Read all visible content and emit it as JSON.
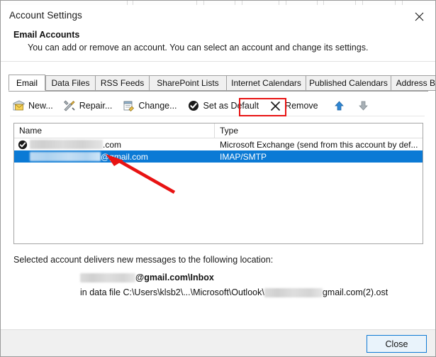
{
  "window": {
    "title": "Account Settings",
    "close_icon": "close-x-icon"
  },
  "header": {
    "heading": "Email Accounts",
    "description": "You can add or remove an account. You can select an account and change its settings."
  },
  "tabs": [
    {
      "label": "Email",
      "active": true
    },
    {
      "label": "Data Files",
      "active": false
    },
    {
      "label": "RSS Feeds",
      "active": false
    },
    {
      "label": "SharePoint Lists",
      "active": false
    },
    {
      "label": "Internet Calendars",
      "active": false
    },
    {
      "label": "Published Calendars",
      "active": false
    },
    {
      "label": "Address Books",
      "active": false
    }
  ],
  "toolbar": {
    "new_label": "New...",
    "repair_label": "Repair...",
    "change_label": "Change...",
    "set_default_label": "Set as Default",
    "remove_label": "Remove",
    "move_up_icon": "arrow-up-icon",
    "move_down_icon": "arrow-down-icon"
  },
  "list": {
    "columns": [
      "Name",
      "Type"
    ],
    "rows": [
      {
        "is_default": true,
        "name_redacted": true,
        "name_suffix": ".com",
        "type": "Microsoft Exchange (send from this account by def...",
        "selected": false
      },
      {
        "is_default": false,
        "name_redacted": true,
        "name_suffix": "@gmail.com",
        "type": "IMAP/SMTP",
        "selected": true
      }
    ]
  },
  "delivery": {
    "label": "Selected account delivers new messages to the following location:",
    "mailbox_suffix": "@gmail.com\\Inbox",
    "datafile_prefix": "in data file C:\\Users\\klsb2\\...\\Microsoft\\Outlook\\",
    "datafile_suffix": "gmail.com(2).ost"
  },
  "footer": {
    "close_label": "Close"
  },
  "annotations": {
    "remove_highlight_color": "#e81313",
    "arrow_color": "#e81313"
  },
  "colors": {
    "selection_blue": "#0b7ad5",
    "focus_border": "#0f7ad5",
    "dialog_bg": "#ffffff",
    "footer_bg": "#f0f0f0"
  }
}
